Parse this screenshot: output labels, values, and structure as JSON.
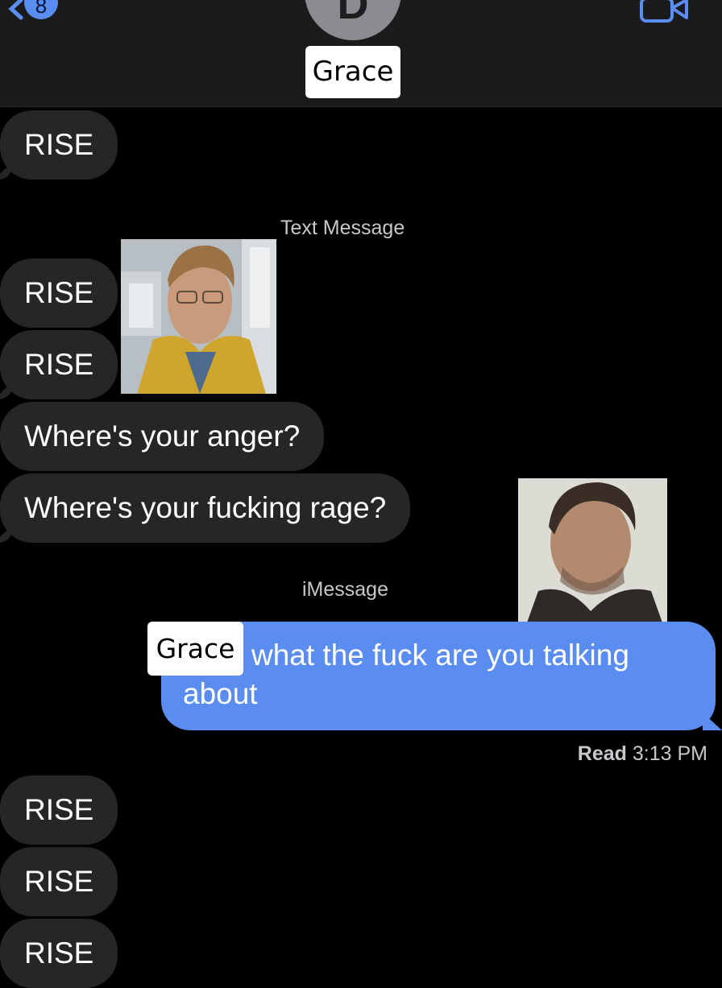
{
  "header": {
    "back_badge": "8",
    "avatar_initial": "D",
    "contact_name": "Grace"
  },
  "messages": {
    "rise_1": "RISE",
    "timestamp_1": "Text Message",
    "rise_2": "RISE",
    "rise_3": "RISE",
    "anger": "Where's your anger?",
    "rage": "Where's your fucking rage?",
    "timestamp_2": "iMessage",
    "sent_tag": "Grace",
    "sent_line_1": "what the fuck are you talking",
    "sent_line_2": "about",
    "read_label": "Read",
    "read_time": "3:13 PM",
    "rise_4": "RISE",
    "rise_5": "RISE",
    "rise_6": "RISE"
  },
  "colors": {
    "incoming_bubble": "#262628",
    "outgoing_bubble": "#5b8df0",
    "background": "#000000"
  }
}
